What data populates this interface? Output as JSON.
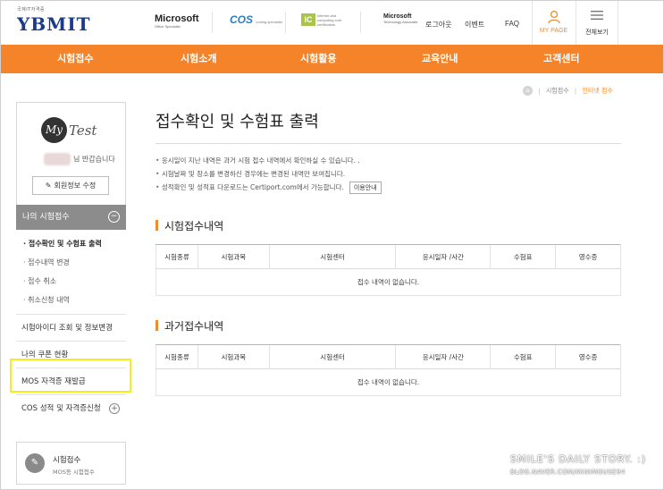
{
  "header": {
    "logo_small": "국제IT자격증",
    "logo": "YBMIT",
    "partners": {
      "microsoft": "Microsoft",
      "microsoft_sub": "Office Specialist",
      "cos": "COS",
      "cos_sub": "coding specialist",
      "ic3": "IC",
      "ic3_sub": "internet and computing core certification",
      "mta": "Microsoft",
      "mta_sub": "Technology Associate"
    },
    "links": {
      "logout": "로그아웃",
      "event": "이벤트",
      "faq": "FAQ"
    },
    "mypage": "MY PAGE",
    "all_menu": "전체보기"
  },
  "nav": [
    "시험접수",
    "시험소개",
    "시험활용",
    "교육안내",
    "고객센터"
  ],
  "breadcrumb": {
    "level1": "시험접수",
    "current": "인터넷 접수"
  },
  "sidebar": {
    "my_logo": "My",
    "my_test": "Test",
    "greeting": "님 반갑습니다",
    "edit_button": "회원정보 수정",
    "section": "나의 시험접수",
    "sub_items": [
      "접수확인 및 수험표 출력",
      "접수내역 변경",
      "접수 취소",
      "취소신청 내역"
    ],
    "links": [
      "시험아이디 조회 및 정보변경",
      "나의 쿠폰 현황",
      "MOS 자격증 재발급",
      "COS 성적 및 자격증신청"
    ],
    "apply_title": "시험접수",
    "apply_sub": "MOS등 시험접수"
  },
  "main": {
    "title": "접수확인 및 수험표 출력",
    "notes": [
      "응시일이 지난 내역은 과거 시험 접수 내역에서 확인하실 수 있습니다. .",
      "시험날짜 및 장소를 변경하신 경우에는 변경된 내역만 보여집니다.",
      "성적확인 및 성적표 다운로드는 Certiport.com에서 가능합니다."
    ],
    "guide_button": "이용안내",
    "current_section": "시험접수내역",
    "past_section": "과거접수내역",
    "columns": [
      "시험종류",
      "시험과목",
      "시험센터",
      "응시일자 /사간",
      "수험표",
      "영수증"
    ],
    "empty_message": "접수 내역이 없습니다."
  },
  "watermark": {
    "line1": "SMILE'S DAILY STORY. :)",
    "line2": "BLOG.NAVER.COM/MINIMOUSE94"
  },
  "colors": {
    "nav_orange": "#f5832a",
    "accent_orange": "#f08c2e",
    "highlight_yellow": "#f4f020",
    "section_gray": "#8c8c8c"
  }
}
